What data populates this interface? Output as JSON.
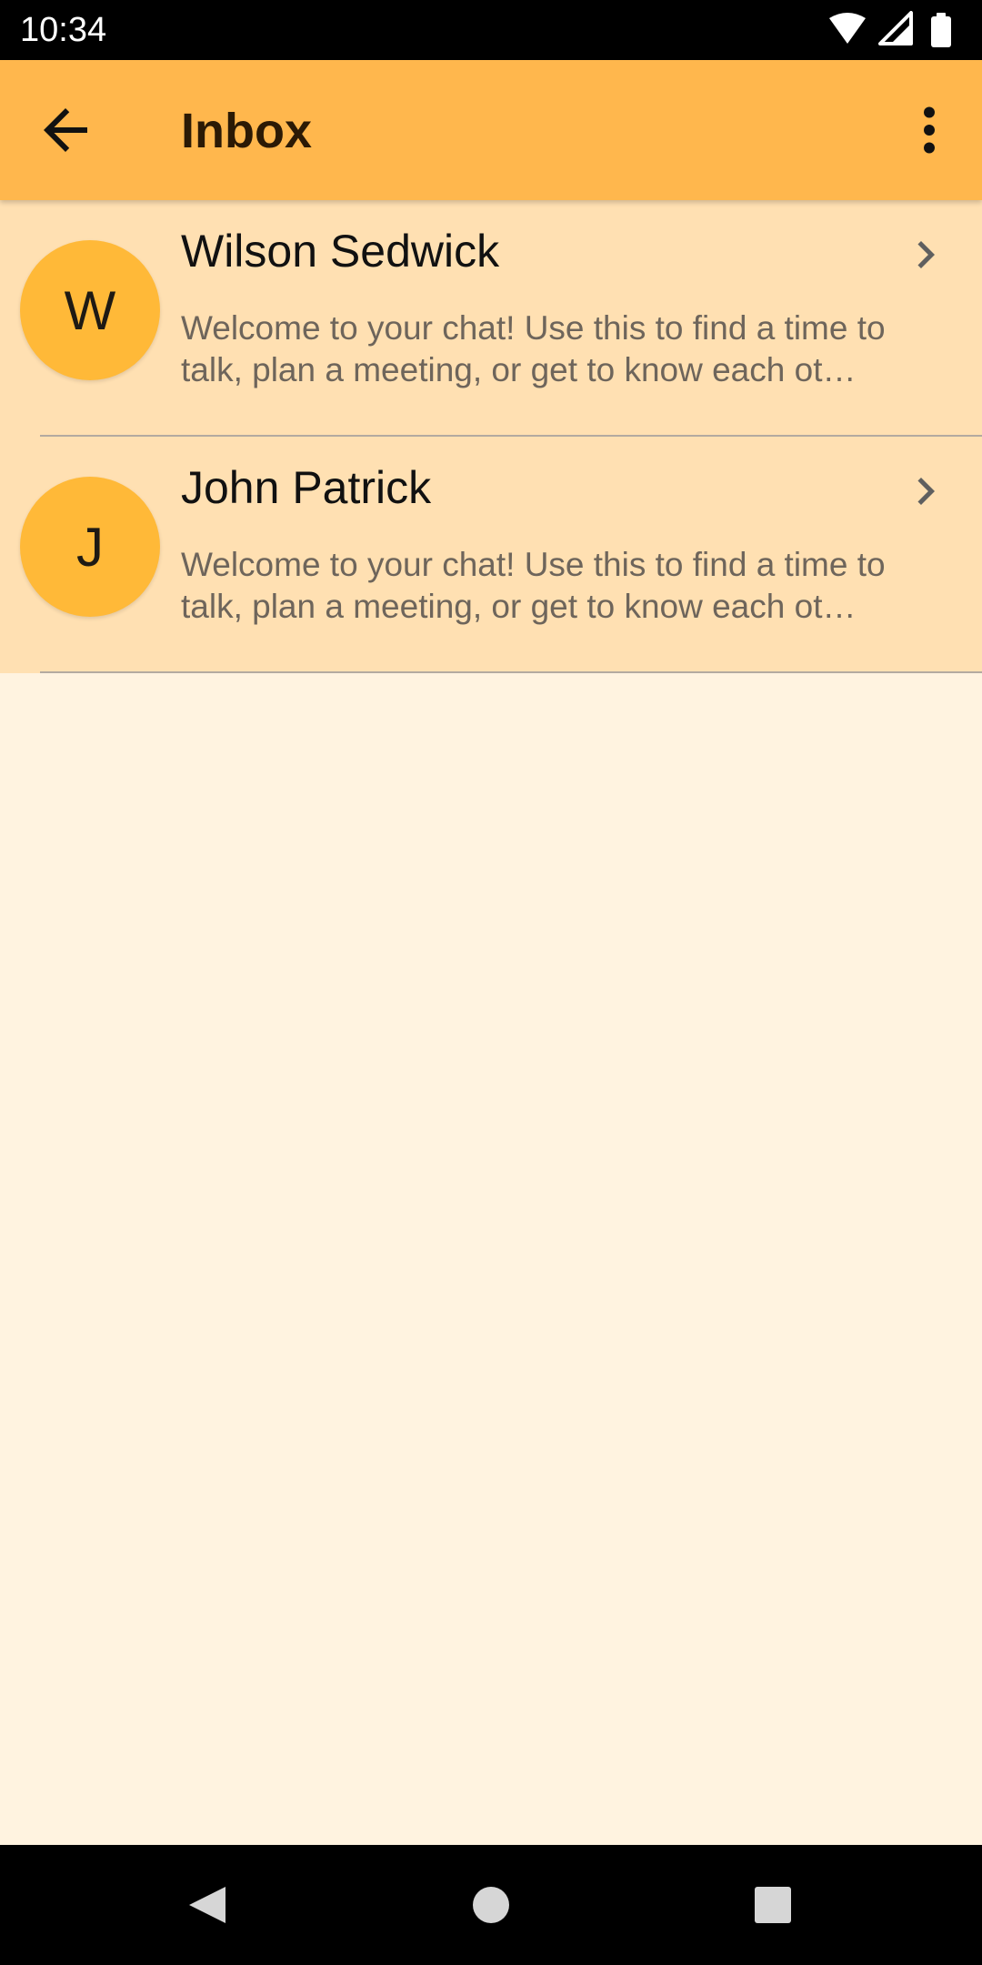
{
  "status_bar": {
    "time": "10:34",
    "icons": [
      "wifi-icon",
      "cell-signal-icon",
      "battery-icon"
    ]
  },
  "app_bar": {
    "title": "Inbox",
    "back_icon": "arrow-back-icon",
    "menu_icon": "more-vert-icon"
  },
  "conversations": [
    {
      "initial": "W",
      "name": "Wilson Sedwick",
      "preview": "Welcome to your chat! Use this to find a time to talk, plan a meeting, or get to know each ot…"
    },
    {
      "initial": "J",
      "name": "John Patrick",
      "preview": "Welcome to your chat! Use this to find a time to talk, plan a meeting, or get to know each ot…"
    }
  ],
  "nav_bar": {
    "icons": [
      "nav-back-icon",
      "nav-home-icon",
      "nav-recents-icon"
    ]
  },
  "colors": {
    "app_bar": "#FFB74D",
    "list_item": "#FFE0B2",
    "background": "#FFF3E0",
    "avatar": "#FFB938",
    "divider": "#B3AAA0"
  }
}
